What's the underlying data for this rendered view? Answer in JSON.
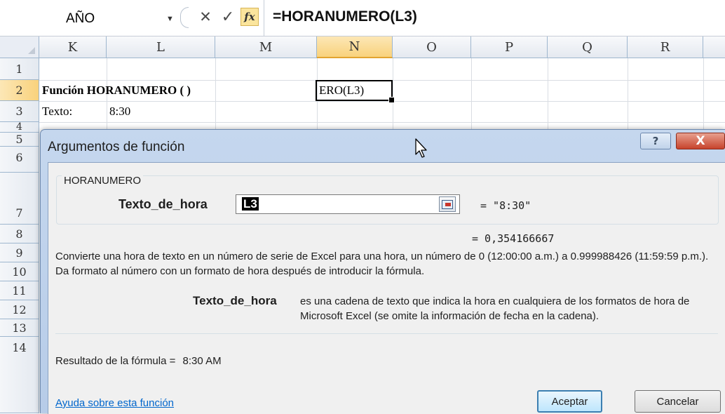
{
  "formula_bar": {
    "name_box": "AÑO",
    "dropdown_glyph": "▼",
    "cancel_glyph": "✕",
    "enter_glyph": "✓",
    "fx_label": "fx",
    "formula": "=HORANUMERO(L3)"
  },
  "grid": {
    "columns": [
      "K",
      "L",
      "M",
      "N",
      "O",
      "P",
      "Q",
      "R"
    ],
    "active_column": "N",
    "rows": [
      "1",
      "2",
      "3",
      "4",
      "5",
      "6",
      "7",
      "8",
      "9",
      "10",
      "11",
      "12",
      "13",
      "14"
    ],
    "active_row": "2",
    "cells": {
      "k2": "Función HORANUMERO ( )",
      "k3": "Texto:",
      "l3": "8:30",
      "n2": "ERO(L3)"
    }
  },
  "dialog": {
    "title": "Argumentos de función",
    "help_glyph": "?",
    "close_glyph": "X",
    "function_name": "HORANUMERO",
    "arg_label": "Texto_de_hora",
    "arg_input_value": "L3",
    "arg_value": "=  \"8:30\"",
    "result_value": "=  0,354166667",
    "description": "Convierte una hora de texto en un número de serie de Excel para una hora, un número de 0 (12:00:00 a.m.) a 0.999988426 (11:59:59 p.m.). Da formato al número con un formato de hora después de introducir la fórmula.",
    "arg_desc_name": "Texto_de_hora",
    "arg_desc_text": "es una cadena de texto que indica la hora en cualquiera de los formatos de hora de Microsoft Excel (se omite la información de fecha en la cadena).",
    "result_label": "Resultado de la fórmula =",
    "result_text": "8:30 AM",
    "help_link": "Ayuda sobre esta función",
    "ok_label": "Aceptar",
    "cancel_label": "Cancelar"
  }
}
